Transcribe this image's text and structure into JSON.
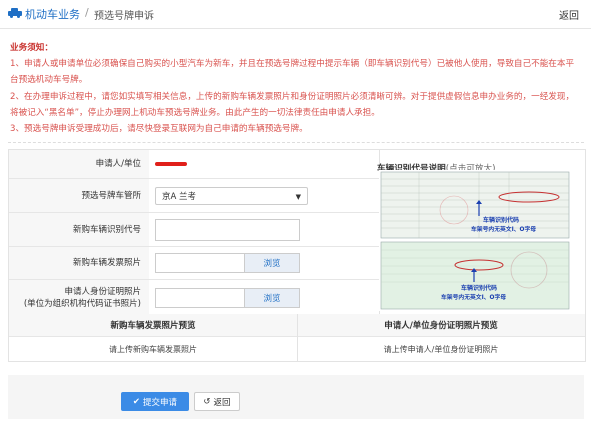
{
  "header": {
    "title": "机动车业务",
    "separator": "/",
    "subtitle": "预选号牌申诉",
    "back_label": "返回"
  },
  "notice": {
    "heading": "业务须知：",
    "items": [
      "1、申请人或申请单位必须确保自己购买的小型汽车为新车，并且在预选号牌过程中提示车辆（即车辆识别代号）已被他人使用，导致自己不能在本平台预选机动车号牌。",
      "2、在办理申诉过程中，请您如实填写相关信息，上传的新购车辆发票照片和身份证明照片必须清晰可辨。对于提供虚假信息申办业务的，一经发现，将被记入“黑名单”，停止办理网上机动车预选号牌业务。由此产生的一切法律责任由申请人承担。",
      "3、预选号牌申诉受理成功后，请尽快登录互联网为自己申请的车辆预选号牌。"
    ]
  },
  "form": {
    "applicant_label": "申请人/单位",
    "plate_office_label": "预选号牌车管所",
    "plate_office_value": "京A 兰考",
    "vin_label": "新购车辆识别代号",
    "invoice_label": "新购车辆发票照片",
    "id_label_line1": "申请人身份证明照片",
    "id_label_line2": "(单位为组织机构代码证书照片)",
    "browse_label": "浏览"
  },
  "sample": {
    "title": "车辆识别代号说明",
    "hint": "(点击可放大)",
    "note1_line1": "车辆识别代码",
    "note1_line2": "车架号内无英文I、O字母",
    "note2_line1": "车辆识别代码",
    "note2_line2": "车架号内无英文I、O字母"
  },
  "preview": {
    "invoice_header": "新购车辆发票照片预览",
    "invoice_body": "请上传新购车辆发票照片",
    "id_header": "申请人/单位身份证明照片预览",
    "id_body": "请上传申请人/单位身份证明照片"
  },
  "buttons": {
    "submit_label": "提交申请",
    "back_label": "返回"
  },
  "colors": {
    "accent": "#1f6fc5",
    "notice_red": "#d9534f",
    "submit_blue": "#3b8be6"
  }
}
